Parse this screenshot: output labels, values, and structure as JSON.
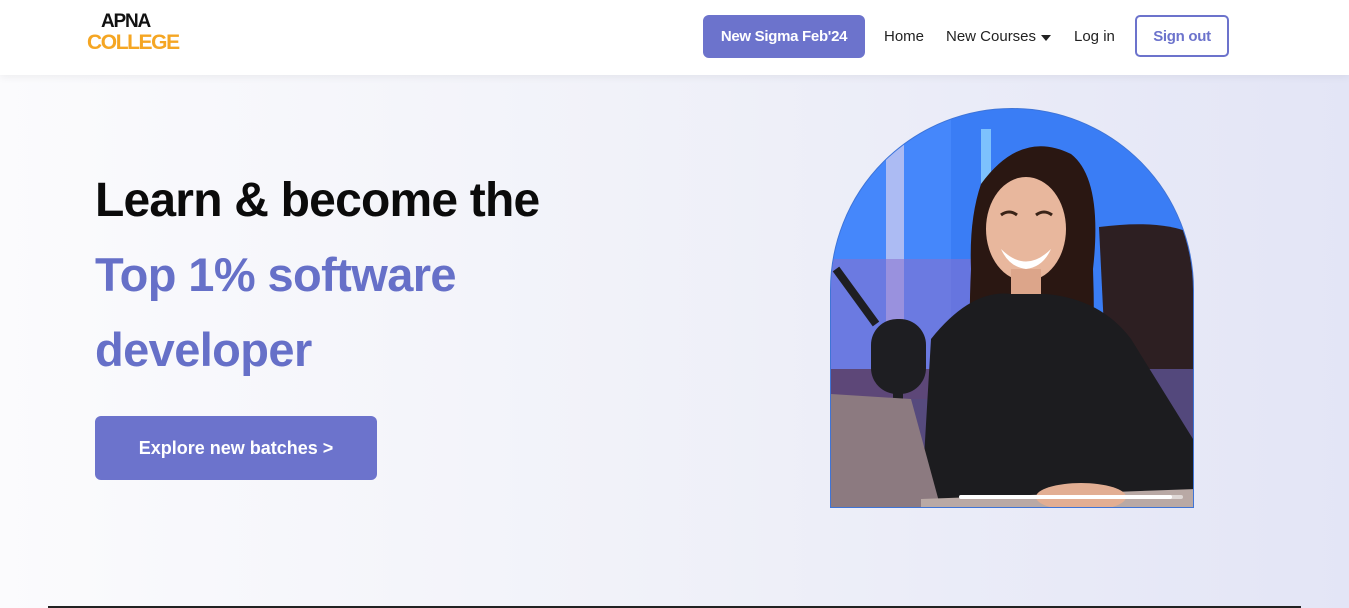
{
  "brand": {
    "logo_top": "APNA",
    "logo_bottom": "COLLEGE",
    "logo_top_color": "#111111",
    "logo_bottom_color": "#f5a623"
  },
  "nav": {
    "cta_label": "New Sigma Feb'24",
    "home": "Home",
    "courses": "New Courses",
    "courses_icon": "caret-down-icon",
    "login": "Log in",
    "signout": "Sign out"
  },
  "hero": {
    "line1": "Learn & become the",
    "line2": "Top 1% software",
    "line3": "developer",
    "cta_label": "Explore new batches >",
    "image_alt": "Instructor smiling at laptop with microphone",
    "video_progress": 0.95
  },
  "colors": {
    "accent": "#6c73cc",
    "heading": "#0b0b0b",
    "highlight": "#6670c8"
  }
}
